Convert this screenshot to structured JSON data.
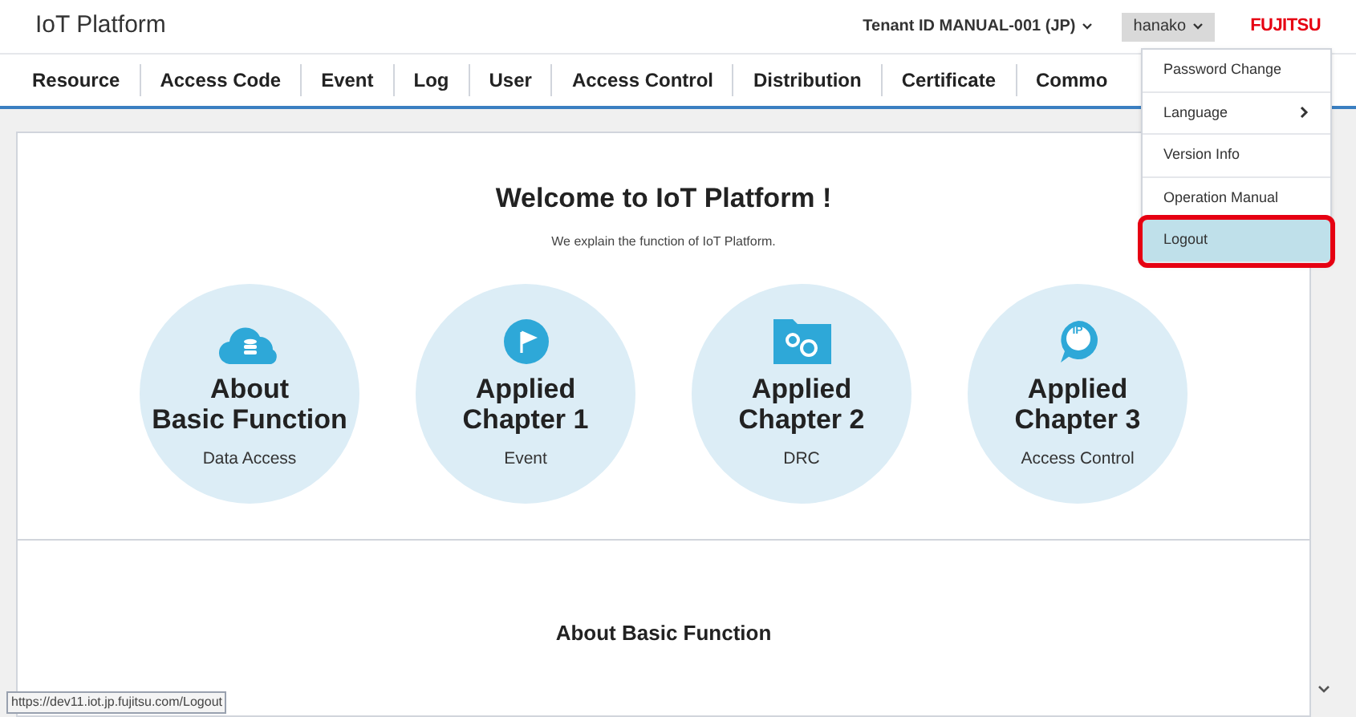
{
  "header": {
    "title": "IoT Platform",
    "tenant": "Tenant ID MANUAL-001 (JP)",
    "user": "hanako",
    "logo": "FUJITSU"
  },
  "nav": [
    "Resource",
    "Access Code",
    "Event",
    "Log",
    "User",
    "Access Control",
    "Distribution",
    "Certificate",
    "Commo"
  ],
  "user_menu": [
    {
      "label": "Password Change",
      "submenu": false,
      "selected": false
    },
    {
      "label": "Language",
      "submenu": true,
      "selected": false
    },
    {
      "label": "Version Info",
      "submenu": false,
      "selected": false
    },
    {
      "label": "Operation Manual",
      "submenu": false,
      "selected": false
    },
    {
      "label": "Logout",
      "submenu": false,
      "selected": true
    }
  ],
  "welcome": {
    "title": "Welcome to IoT Platform !",
    "subtitle": "We explain the function of IoT Platform."
  },
  "chapters": [
    {
      "kind": "cloud",
      "title": "About\nBasic Function",
      "subtitle": "Data Access"
    },
    {
      "kind": "flag",
      "title": "Applied\nChapter 1",
      "subtitle": "Event"
    },
    {
      "kind": "folder",
      "title": "Applied\nChapter 2",
      "subtitle": "DRC"
    },
    {
      "kind": "pin",
      "title": "Applied\nChapter 3",
      "subtitle": "Access Control",
      "icon_text": "IP"
    }
  ],
  "section_title": "About Basic Function",
  "status_url": "https://dev11.iot.jp.fujitsu.com/Logout"
}
